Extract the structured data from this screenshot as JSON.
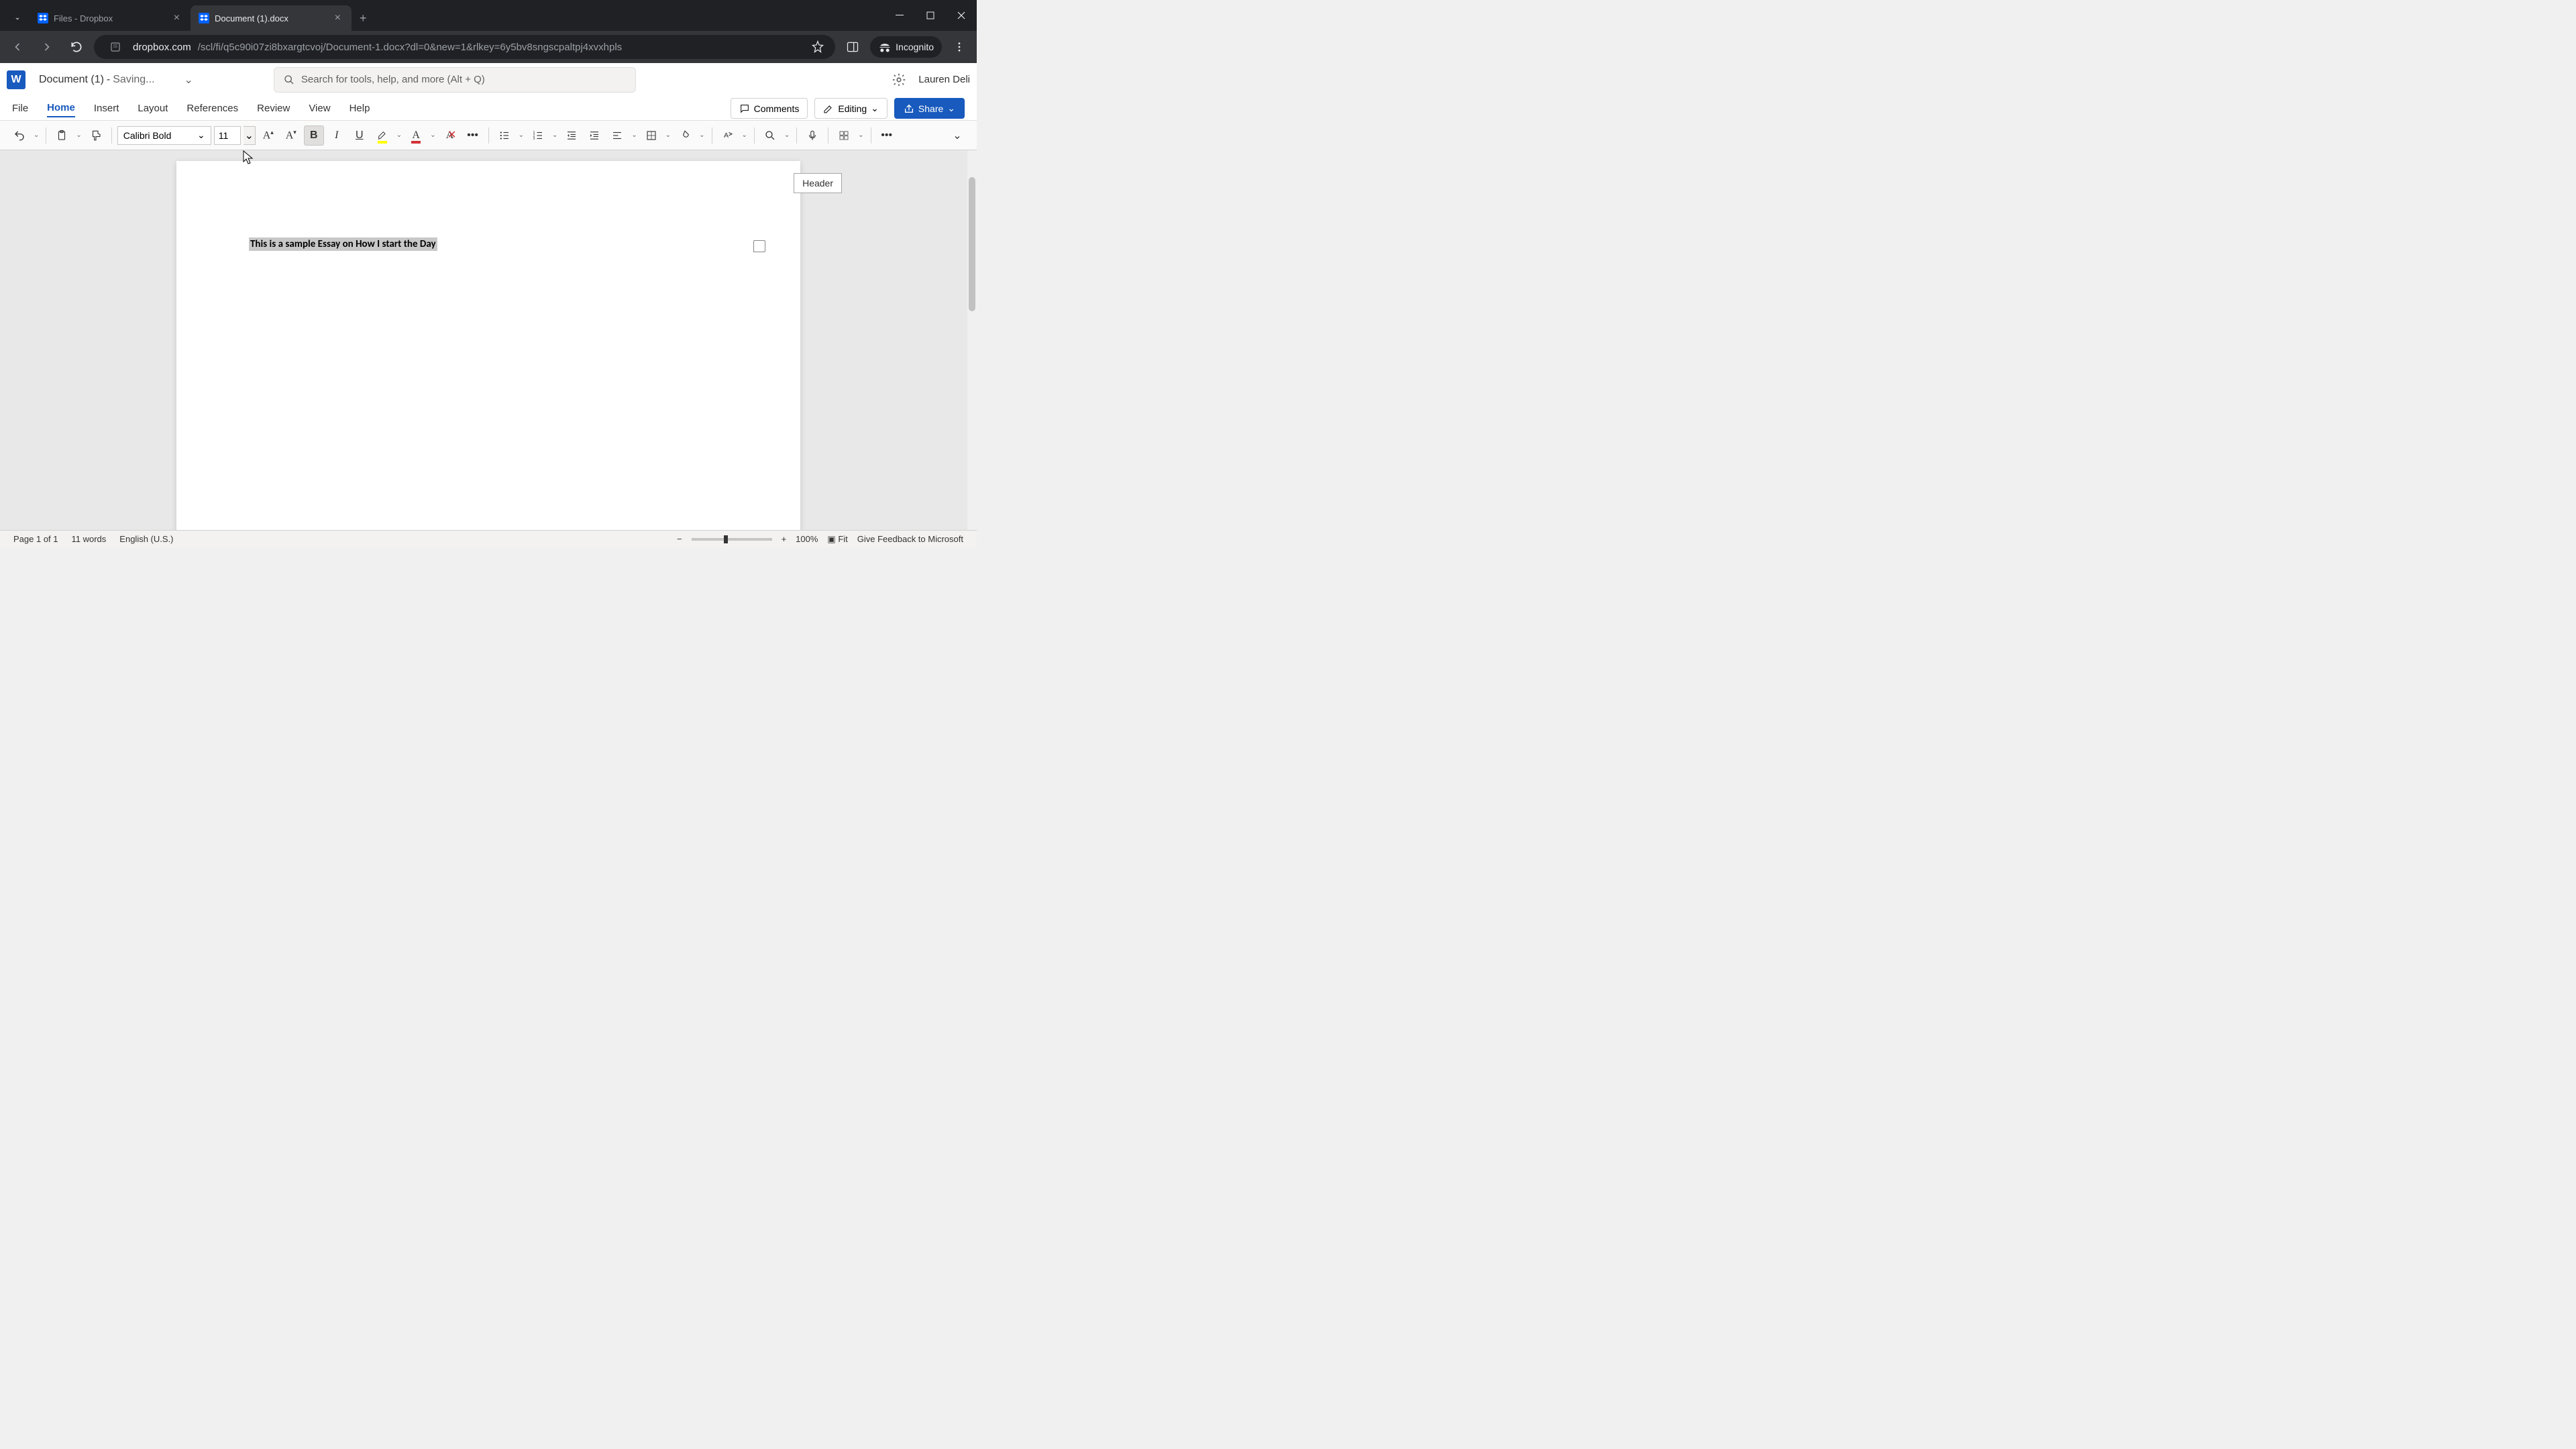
{
  "browser": {
    "tabs": [
      {
        "title": "Files - Dropbox",
        "active": false
      },
      {
        "title": "Document (1).docx",
        "active": true
      }
    ],
    "url_domain": "dropbox.com",
    "url_path": "/scl/fi/q5c90i07zi8bxargtcvoj/Document-1.docx?dl=0&new=1&rlkey=6y5bv8sngscpaltpj4xvxhpls",
    "incognito_label": "Incognito"
  },
  "app": {
    "doc_name": "Document (1)",
    "doc_separator": "-",
    "doc_status": "Saving...",
    "search_placeholder": "Search for tools, help, and more (Alt + Q)",
    "user_name": "Lauren Deli"
  },
  "ribbon": {
    "tabs": [
      "File",
      "Home",
      "Insert",
      "Layout",
      "References",
      "Review",
      "View",
      "Help"
    ],
    "active_tab": "Home",
    "comments_label": "Comments",
    "editing_label": "Editing",
    "share_label": "Share"
  },
  "toolbar": {
    "font_name": "Calibri Bold",
    "font_size": "11",
    "bold_active": true
  },
  "document": {
    "header_badge": "Header",
    "body_text": "This is a sample Essay on How I start the Day"
  },
  "status": {
    "page_info": "Page 1 of 1",
    "word_count": "11 words",
    "language": "English (U.S.)",
    "zoom_percent": "100%",
    "fit_label": "Fit",
    "feedback_label": "Give Feedback to Microsoft"
  }
}
